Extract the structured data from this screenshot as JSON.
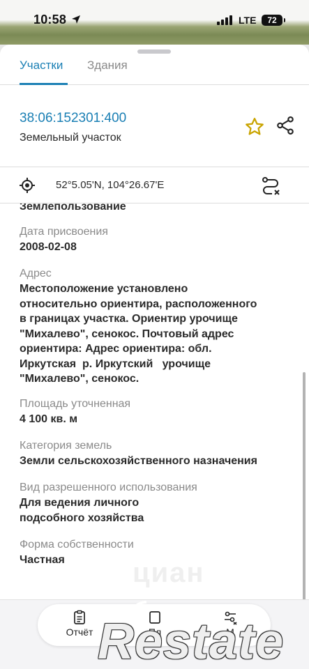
{
  "status_bar": {
    "time": "10:58",
    "network": "LTE",
    "battery": "72"
  },
  "tabs": [
    {
      "label": "Участки",
      "active": true
    },
    {
      "label": "Здания",
      "active": false
    }
  ],
  "parcel": {
    "cadastral_number": "38:06:152301:400",
    "type": "Земельный участок",
    "coordinates": "52°5.05'N, 104°26.67'E"
  },
  "fields": {
    "usage_value": "Землепользование",
    "date_label": "Дата присвоения",
    "date_value": "2008-02-08",
    "address_label": "Адрес",
    "address_line1": "Местоположение установлено",
    "address_line2": "относительно ориентира, расположенного",
    "address_line3": "в границах участка. Ориентир урочище",
    "address_line4": "\"Михалево\", сенокос. Почтовый адрес",
    "address_line5": "ориентира: Адрес ориентира: обл.",
    "address_line6": "Иркутская  р. Иркутский   урочище",
    "address_line7": "\"Михалево\", сенокос.",
    "area_label": "Площадь уточненная",
    "area_value": "4 100 кв. м",
    "category_label": "Категория земель",
    "category_value": "Земли сельскохозяйственного назначения",
    "permitted_use_label": "Вид разрешенного использования",
    "permitted_use_line1": "Для ведения личного",
    "permitted_use_line2": "подсобного хозяйства",
    "ownership_label": "Форма собственности",
    "ownership_value": "Частная"
  },
  "bottom_nav": {
    "report": "Отчёт",
    "plan": "Пл",
    "more": "М"
  },
  "watermarks": {
    "cian": "циан",
    "restate": "Restate"
  },
  "colors": {
    "accent": "#1a7fb4",
    "star": "#c9a400"
  },
  "icons": [
    "location-arrow-icon",
    "star-icon",
    "share-icon",
    "target-icon",
    "route-icon",
    "report-icon",
    "plan-icon",
    "settings-icon"
  ]
}
